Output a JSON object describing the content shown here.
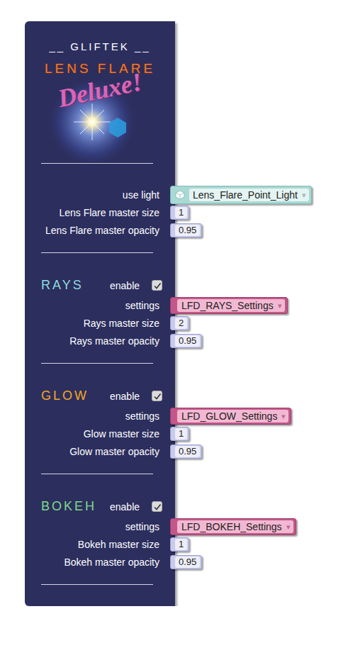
{
  "block": {
    "header": "__ GLIFTEK __",
    "logo": {
      "title": "LENS FLARE",
      "subtitle": "Deluxe!"
    },
    "master": [
      {
        "kind": "light",
        "label": "use light",
        "value": "Lens_Flare_Point_Light",
        "arrow": "▾"
      },
      {
        "kind": "number",
        "label": "Lens Flare master size",
        "value": "1"
      },
      {
        "kind": "number",
        "label": "Lens Flare master opacity",
        "value": "0.95"
      }
    ],
    "sections": [
      {
        "title": "RAYS",
        "color": "#8fdcdc",
        "enable_label": "enable",
        "enabled": true,
        "rows": [
          {
            "kind": "settings",
            "label": "settings",
            "value": "LFD_RAYS_Settings",
            "arrow": "▾"
          },
          {
            "kind": "number",
            "label": "Rays master size",
            "value": "2"
          },
          {
            "kind": "number",
            "label": "Rays master opacity",
            "value": "0.95"
          }
        ]
      },
      {
        "title": "GLOW",
        "color": "#f5a623",
        "enable_label": "enable",
        "enabled": true,
        "rows": [
          {
            "kind": "settings",
            "label": "settings",
            "value": "LFD_GLOW_Settings",
            "arrow": "▾"
          },
          {
            "kind": "number",
            "label": "Glow master size",
            "value": "1"
          },
          {
            "kind": "number",
            "label": "Glow master opacity",
            "value": "0.95"
          }
        ]
      },
      {
        "title": "BOKEH",
        "color": "#7fd98a",
        "enable_label": "enable",
        "enabled": true,
        "rows": [
          {
            "kind": "settings",
            "label": "settings",
            "value": "LFD_BOKEH_Settings",
            "arrow": "▾"
          },
          {
            "kind": "number",
            "label": "Bokeh master size",
            "value": "1"
          },
          {
            "kind": "number",
            "label": "Bokeh master opacity",
            "value": "0.95"
          }
        ]
      }
    ]
  }
}
